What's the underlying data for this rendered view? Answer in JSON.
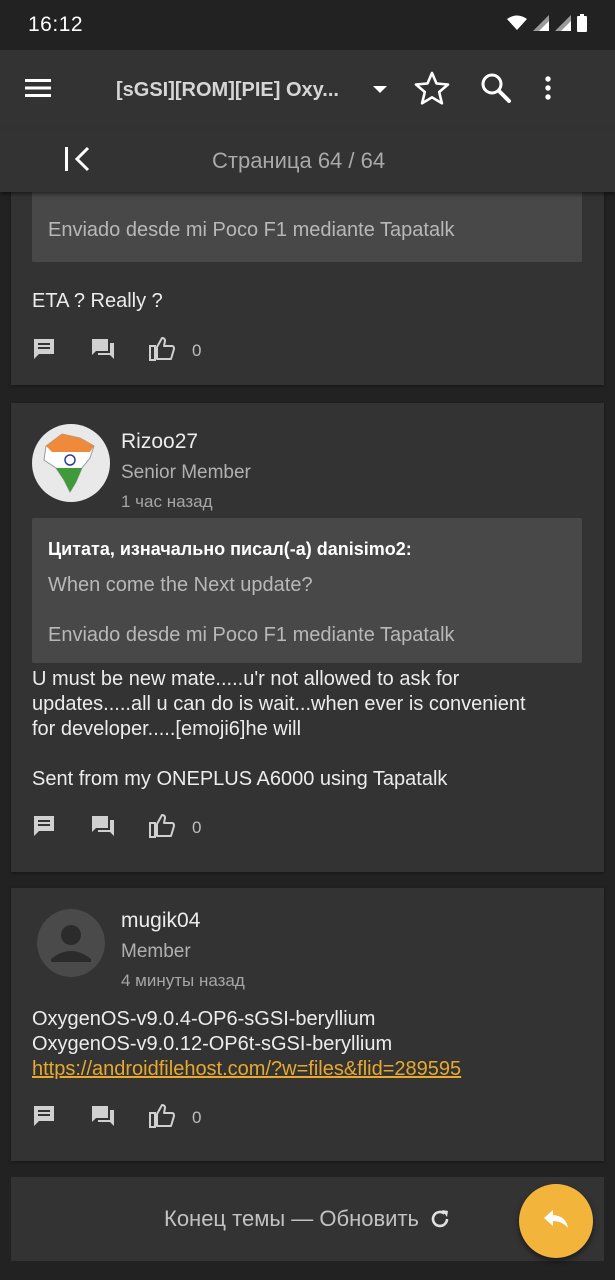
{
  "status_bar": {
    "time": "16:12",
    "icons": [
      "wifi-icon",
      "signal-icon",
      "signal-icon",
      "battery-icon"
    ]
  },
  "toolbar": {
    "title": "[sGSI][ROM][PIE] Oxy...",
    "icons": [
      "menu-icon",
      "dropdown-icon",
      "star-icon",
      "search-icon",
      "more-vert-icon"
    ]
  },
  "pager": {
    "label": "Страница 64 / 64",
    "icon": "first-page-icon"
  },
  "posts": [
    {
      "quote": {
        "text": "Enviado desde mi Poco F1 mediante Tapatalk"
      },
      "body": "ETA ? Really ?",
      "likes": "0"
    },
    {
      "author": "Rizoo27",
      "role": "Senior Member",
      "time": "1 час назад",
      "avatar": "india-map-avatar",
      "quote": {
        "author": "Цитата, изначально писал(-а) danisimo2:",
        "line1": "When come the Next update?",
        "line2": "Enviado desde mi Poco F1 mediante Tapatalk"
      },
      "body_line1": "U must be new mate.....u'r not allowed to ask for",
      "body_line2": "updates.....all u can do is wait...when ever is convenient",
      "body_line3": "for developer.....[emoji6]he will",
      "signature": "Sent from my ONEPLUS A6000 using Tapatalk",
      "likes": "0"
    },
    {
      "author": "mugik04",
      "role": "Member",
      "time": "4 минуты назад",
      "avatar": "default-user-avatar",
      "body_line1": "OxygenOS-v9.0.4-OP6-sGSI-beryllium",
      "body_line2": "OxygenOS-v9.0.12-OP6t-sGSI-beryllium",
      "link": "https://androidfilehost.com/?w=files&flid=289595",
      "likes": "0"
    }
  ],
  "end_bar": {
    "label": "Конец темы — Обновить",
    "icon": "refresh-icon"
  },
  "fab": {
    "icon": "reply-icon"
  },
  "colors": {
    "background": "#222222",
    "card": "#333333",
    "quote": "#484848",
    "accent": "#f2b43b",
    "link": "#e8a92c"
  }
}
